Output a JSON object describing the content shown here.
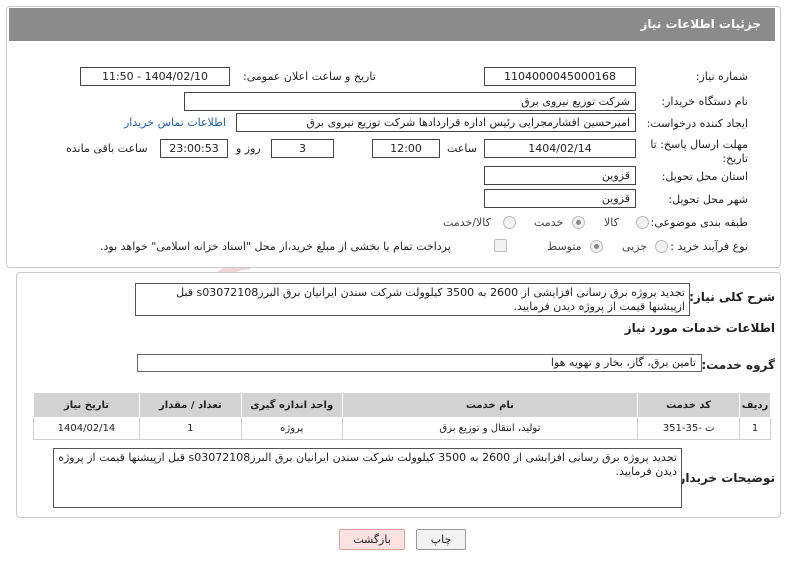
{
  "header": {
    "title": "جزئیات اطلاعات نیاز"
  },
  "fields": {
    "need_number": {
      "label": "شماره نیاز:",
      "value": "1104000045000168"
    },
    "announce_datetime": {
      "label": "تاریخ و ساعت اعلان عمومی:",
      "value": "1404/02/10 - 11:50"
    },
    "buyer_org": {
      "label": "نام دستگاه خریدار:",
      "value": "شرکت توزیع نیروی برق"
    },
    "requester": {
      "label": "ایجاد کننده درخواست:",
      "value": "امیرحسین افشارمجرایی رئیس اداره قراردادها شرکت توزیع نیروی برق",
      "link": "اطلاعات تماس خریدار"
    },
    "deadline": {
      "label": "مهلت ارسال پاسخ: تا تاریخ:",
      "date": "1404/02/14",
      "time_label": "ساعت",
      "time": "12:00",
      "days": "3",
      "days_label": "روز و",
      "remaining": "23:00:53",
      "remaining_label": "ساعت باقی مانده"
    },
    "province": {
      "label": "استان محل تحویل:",
      "value": "قزوین"
    },
    "city": {
      "label": "شهر محل تحویل:",
      "value": "قزوین"
    },
    "category": {
      "label": "طبقه بندی موضوعی:",
      "options": [
        "کالا",
        "خدمت",
        "کالا/خدمت"
      ],
      "selected": "خدمت"
    },
    "purchase_type": {
      "label": "نوع فرآیند خرید :",
      "options": [
        "جزیی",
        "متوسط"
      ],
      "selected": "متوسط",
      "note": "پرداخت تمام یا بخشی از مبلغ خرید،از محل \"اسناد خزانه اسلامی\" خواهد بود."
    }
  },
  "summary": {
    "label": "شرح کلی نیاز:",
    "text": "تجدید پروژه برق رسانی افزایشی از 2600 به 3500 کیلوولت شرکت سندن ایرانیان برق البرزs03072108  قبل ازپیشنها قیمت از پروژه دیدن فرمایید."
  },
  "services": {
    "section_title": "اطلاعات خدمات مورد نیاز",
    "group_label": "گروه خدمت:",
    "group_value": "تامین برق، گاز، بخار و تهویه هوا",
    "columns": [
      "ردیف",
      "کد خدمت",
      "نام خدمت",
      "واحد اندازه گیری",
      "تعداد / مقدار",
      "تاریخ نیاز"
    ],
    "rows": [
      [
        "1",
        "ت -35-351",
        "تولید، انتقال و توزیع برق",
        "پروژه",
        "1",
        "1404/02/14"
      ]
    ]
  },
  "buyer_notes": {
    "label": "توضیحات خریدار:",
    "text": "تجدید پروژه برق رسانی افزایشی از 2600 به 3500 کیلوولت شرکت سندن ایرانیان برق البرزs03072108  قبل ازپیشنها قیمت از پروژه دیدن فرمایید."
  },
  "buttons": {
    "print": "چاپ",
    "back": "بازگشت"
  },
  "watermark": {
    "text": "AriaTender.net"
  },
  "colors": {
    "header_bg": "#8b8b8b",
    "link": "#1a5fb4",
    "back_button_bg": "#fde2e2",
    "watermark": "#e8c9c9"
  }
}
